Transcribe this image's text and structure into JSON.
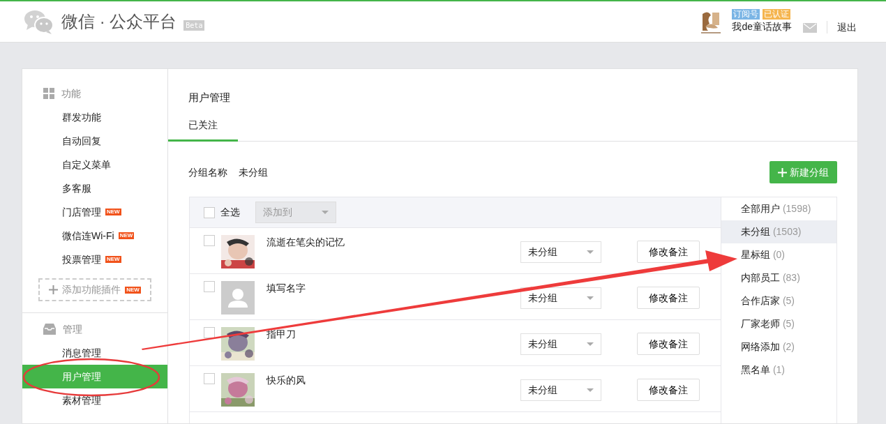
{
  "header": {
    "logo_text": "微信 · 公众平台",
    "beta": "Beta",
    "account_tags": [
      {
        "text": "订阅号",
        "color": "#7bb5e5"
      },
      {
        "text": "已认证",
        "color": "#f5b54f"
      }
    ],
    "account_name": "我de童话故事",
    "logout": "退出"
  },
  "sidebar": {
    "sections": [
      {
        "title": "功能",
        "kind": "grid",
        "items": [
          {
            "label": "群发功能",
            "selected": false
          },
          {
            "label": "自动回复",
            "selected": false
          },
          {
            "label": "自定义菜单",
            "selected": false
          },
          {
            "label": "多客服",
            "selected": false
          },
          {
            "label": "门店管理",
            "badge": "NEW",
            "selected": false
          },
          {
            "label": "微信连Wi-Fi",
            "badge": "NEW",
            "selected": false
          },
          {
            "label": "投票管理",
            "badge": "NEW",
            "selected": false
          }
        ],
        "add_plugin": {
          "label": "添加功能插件",
          "badge": "NEW"
        }
      },
      {
        "title": "管理",
        "kind": "inbox",
        "items": [
          {
            "label": "消息管理",
            "selected": false
          },
          {
            "label": "用户管理",
            "selected": true
          },
          {
            "label": "素材管理",
            "selected": false
          }
        ]
      }
    ]
  },
  "content": {
    "title": "用户管理",
    "tabs": [
      {
        "label": "已关注",
        "selected": true
      }
    ],
    "group_label": "分组名称",
    "group_value": "未分组",
    "new_group_button": "新建分组",
    "table": {
      "select_all": {
        "label": "全选",
        "checked": false
      },
      "add_to": {
        "label": "添加到",
        "disabled": true
      },
      "rows": [
        {
          "name": "流逝在笔尖的记忆",
          "kind": "picture",
          "group": "未分组",
          "remark_button": "修改备注",
          "checked": false
        },
        {
          "name": "填写名字",
          "kind": "default",
          "group": "未分组",
          "remark_button": "修改备注",
          "checked": false
        },
        {
          "name": "指甲刀",
          "kind": "picture",
          "group": "未分组",
          "remark_button": "修改备注",
          "checked": false
        },
        {
          "name": "快乐的风",
          "kind": "picture",
          "group": "未分组",
          "remark_button": "修改备注",
          "checked": false
        }
      ]
    },
    "groups": [
      {
        "name": "全部用户",
        "count": "(1598)",
        "selected": false
      },
      {
        "name": "未分组",
        "count": "(1503)",
        "selected": true
      },
      {
        "name": "星标组",
        "count": "(0)",
        "selected": false
      },
      {
        "name": "内部员工",
        "count": "(83)",
        "selected": false
      },
      {
        "name": "合作店家",
        "count": "(5)",
        "selected": false
      },
      {
        "name": "厂家老师",
        "count": "(5)",
        "selected": false
      },
      {
        "name": "网络添加",
        "count": "(2)",
        "selected": false
      },
      {
        "name": "黑名单",
        "count": "(1)",
        "selected": false
      }
    ]
  },
  "annotations": [
    {
      "kind": "ellipse"
    },
    {
      "kind": "arrow"
    }
  ]
}
